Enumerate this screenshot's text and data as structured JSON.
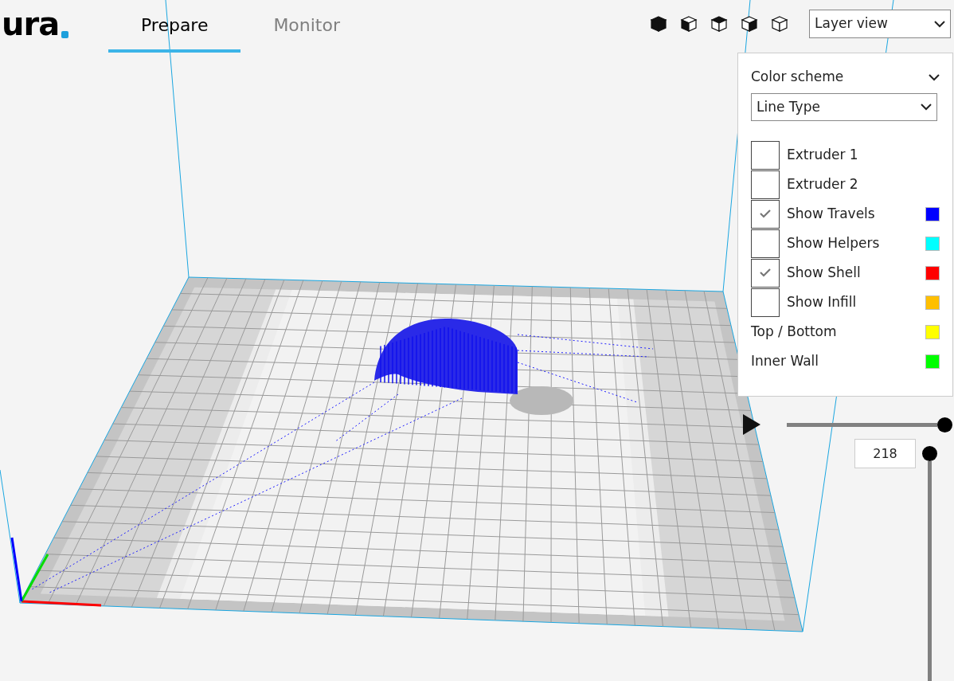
{
  "logo": {
    "text": "ura"
  },
  "tabs": [
    {
      "label": "Prepare",
      "selected": true
    },
    {
      "label": "Monitor",
      "selected": false
    }
  ],
  "view_select": {
    "value": "Layer view"
  },
  "panel": {
    "title": "Color scheme",
    "expanded": true,
    "scheme_select": {
      "value": "Line Type"
    },
    "options": [
      {
        "kind": "checkbox",
        "label": "Extruder 1",
        "checked": false
      },
      {
        "kind": "checkbox",
        "label": "Extruder 2",
        "checked": false
      },
      {
        "kind": "checkbox",
        "label": "Show Travels",
        "checked": true,
        "color": "#0000ff"
      },
      {
        "kind": "checkbox",
        "label": "Show Helpers",
        "checked": false,
        "color": "#00ffff"
      },
      {
        "kind": "checkbox",
        "label": "Show Shell",
        "checked": true,
        "color": "#ff0000"
      },
      {
        "kind": "checkbox",
        "label": "Show Infill",
        "checked": false,
        "color": "#ffbf00"
      },
      {
        "kind": "legend",
        "label": "Top / Bottom",
        "color": "#ffff00"
      },
      {
        "kind": "legend",
        "label": "Inner Wall",
        "color": "#00ff00"
      }
    ]
  },
  "layer_slider": {
    "level": 1
  },
  "height_slider": {
    "level": 1,
    "value": "218"
  }
}
